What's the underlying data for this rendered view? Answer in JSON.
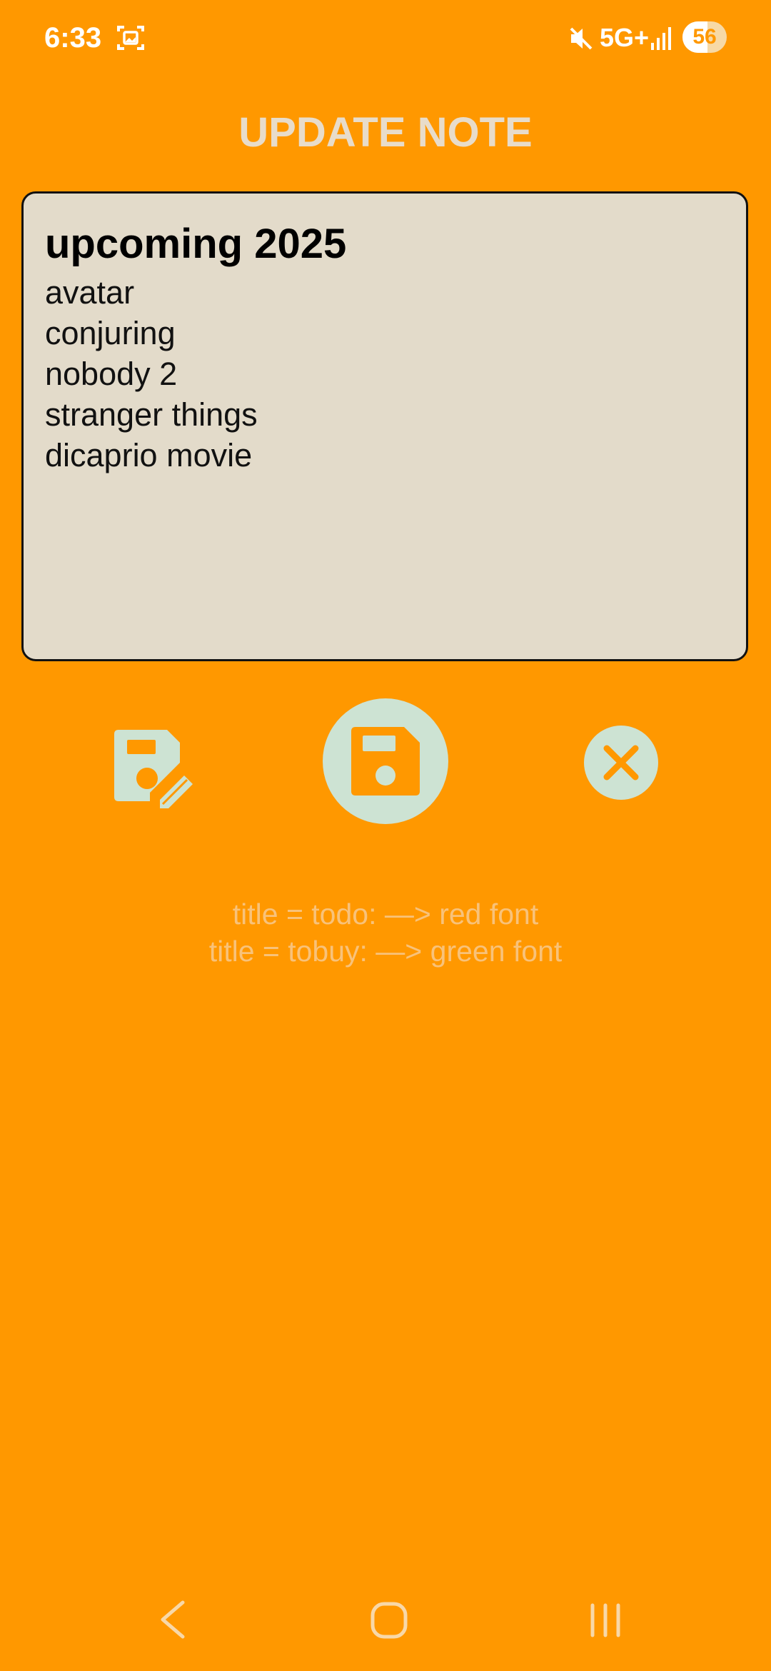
{
  "status_bar": {
    "time": "6:33",
    "network": "5G+",
    "battery_level": "56",
    "battery_fraction": 0.56,
    "icons": [
      "screenshot-icon",
      "mute-icon",
      "signal-icon",
      "battery-icon"
    ]
  },
  "page": {
    "title": "UPDATE NOTE"
  },
  "note": {
    "title": "upcoming 2025",
    "lines": [
      "avatar",
      "conjuring",
      "nobody 2",
      "stranger things",
      "dicaprio movie"
    ]
  },
  "actions": {
    "icons": [
      "edit-save-icon",
      "save-icon",
      "close-icon"
    ]
  },
  "hints": [
    "title = todo: —> red font",
    "title = tobuy: —> green font"
  ],
  "nav": {
    "icons": [
      "back-icon",
      "home-icon",
      "recents-icon"
    ]
  },
  "colors": {
    "background": "#FF9800",
    "card": "#E3DBCA",
    "button": "#CDE3D3",
    "title": "#E8DCCA",
    "hint": "#F8C27A"
  }
}
